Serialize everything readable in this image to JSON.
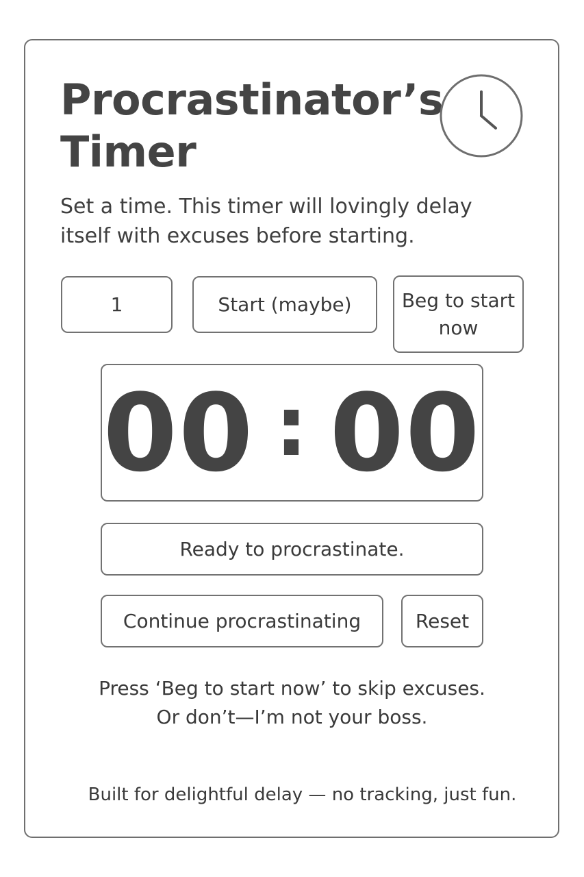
{
  "app": {
    "title": "Procrastinator’s Timer",
    "subtitle": "Set a time. This timer will lovingly delay itself with excuses before starting."
  },
  "controls": {
    "minutes_value": "1",
    "start_label": "Start (maybe)",
    "beg_label": "Beg to start now"
  },
  "timer": {
    "minutes": "00",
    "separator": ":",
    "seconds": "00"
  },
  "status": {
    "text": "Ready to procrastinate."
  },
  "actions": {
    "continue_label": "Continue procrastinating",
    "reset_label": "Reset"
  },
  "hint": {
    "line1": "Press ‘Beg to start now’ to skip excuses.",
    "line2": "Or don’t—I’m not your boss."
  },
  "footer": {
    "text": "Built for delightful delay — no tracking, just fun."
  },
  "icons": {
    "header_icon": "clock-icon"
  },
  "colors": {
    "text": "#3a3a3a",
    "border": "#727272",
    "background": "#ffffff"
  }
}
